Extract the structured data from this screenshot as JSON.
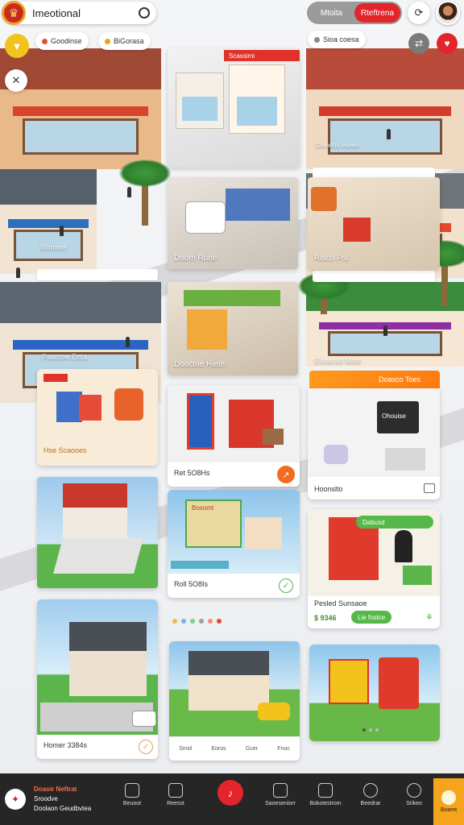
{
  "header": {
    "search_title": "Imeotional",
    "toggle": {
      "option_a": "Mtoita",
      "option_b": "Rteftrena"
    },
    "icons": {
      "logo": "lion-logo-icon",
      "search": "search-icon",
      "refresh": "refresh-icon"
    }
  },
  "chips": [
    {
      "label": "Goodinse"
    },
    {
      "label": "BiGorasa"
    },
    {
      "label": "Sioa coesa"
    }
  ],
  "map_labels": {
    "left_street": "Wilmore",
    "top_card_caption": "Dlooriod eseeo"
  },
  "tiles": [
    {
      "label": "Doom Rune"
    },
    {
      "label": "Rlsco Frit"
    },
    {
      "label": "Paatcow Ertta"
    },
    {
      "label": "Dooctoe Hiete"
    },
    {
      "label": "Elusarad Mate"
    }
  ],
  "ribbons": [
    {
      "label": "Scassimi"
    },
    {
      "label": "Dabusd"
    },
    {
      "label": "Doasco Toes"
    }
  ],
  "cards": [
    {
      "caption": "Hse Scaooes"
    },
    {
      "caption": "Ret 5O8Hs"
    },
    {
      "caption": "Hoonslto"
    },
    {
      "caption": "Roll 5O8Is"
    },
    {
      "caption": "Pesled Sunsaoe",
      "price": "$ 9346",
      "button": "Lie fostce"
    },
    {
      "caption": "Homer 3384s"
    }
  ],
  "card_badges": {
    "store_sign": "Ohouise",
    "retail_sign": "Bosomt"
  },
  "mini_tabs": [
    "Smid",
    "Eoros",
    "Gcer",
    "Fnoc"
  ],
  "carousel": {
    "dot_colors": [
      "#f2b84b",
      "#7ab6d8",
      "#7ecf95",
      "#a0a0a0",
      "#f28b7a",
      "#e04b3b"
    ]
  },
  "bottom_nav": {
    "brand_line1": "Doaoir Neftrat",
    "brand_line2": "Sroodve",
    "brand_line3": "Doolaon Geudbvtea",
    "items": [
      "Beuoot",
      "Reesst",
      "Saoeseniorr",
      "Bokotestrom",
      "Beedrar",
      "Srikeo"
    ],
    "right_label": "Boamt"
  },
  "colors": {
    "accent_red": "#e3242b",
    "accent_orange": "#f26b21",
    "accent_yellow": "#f2c21d",
    "nav_bg": "#262626"
  }
}
